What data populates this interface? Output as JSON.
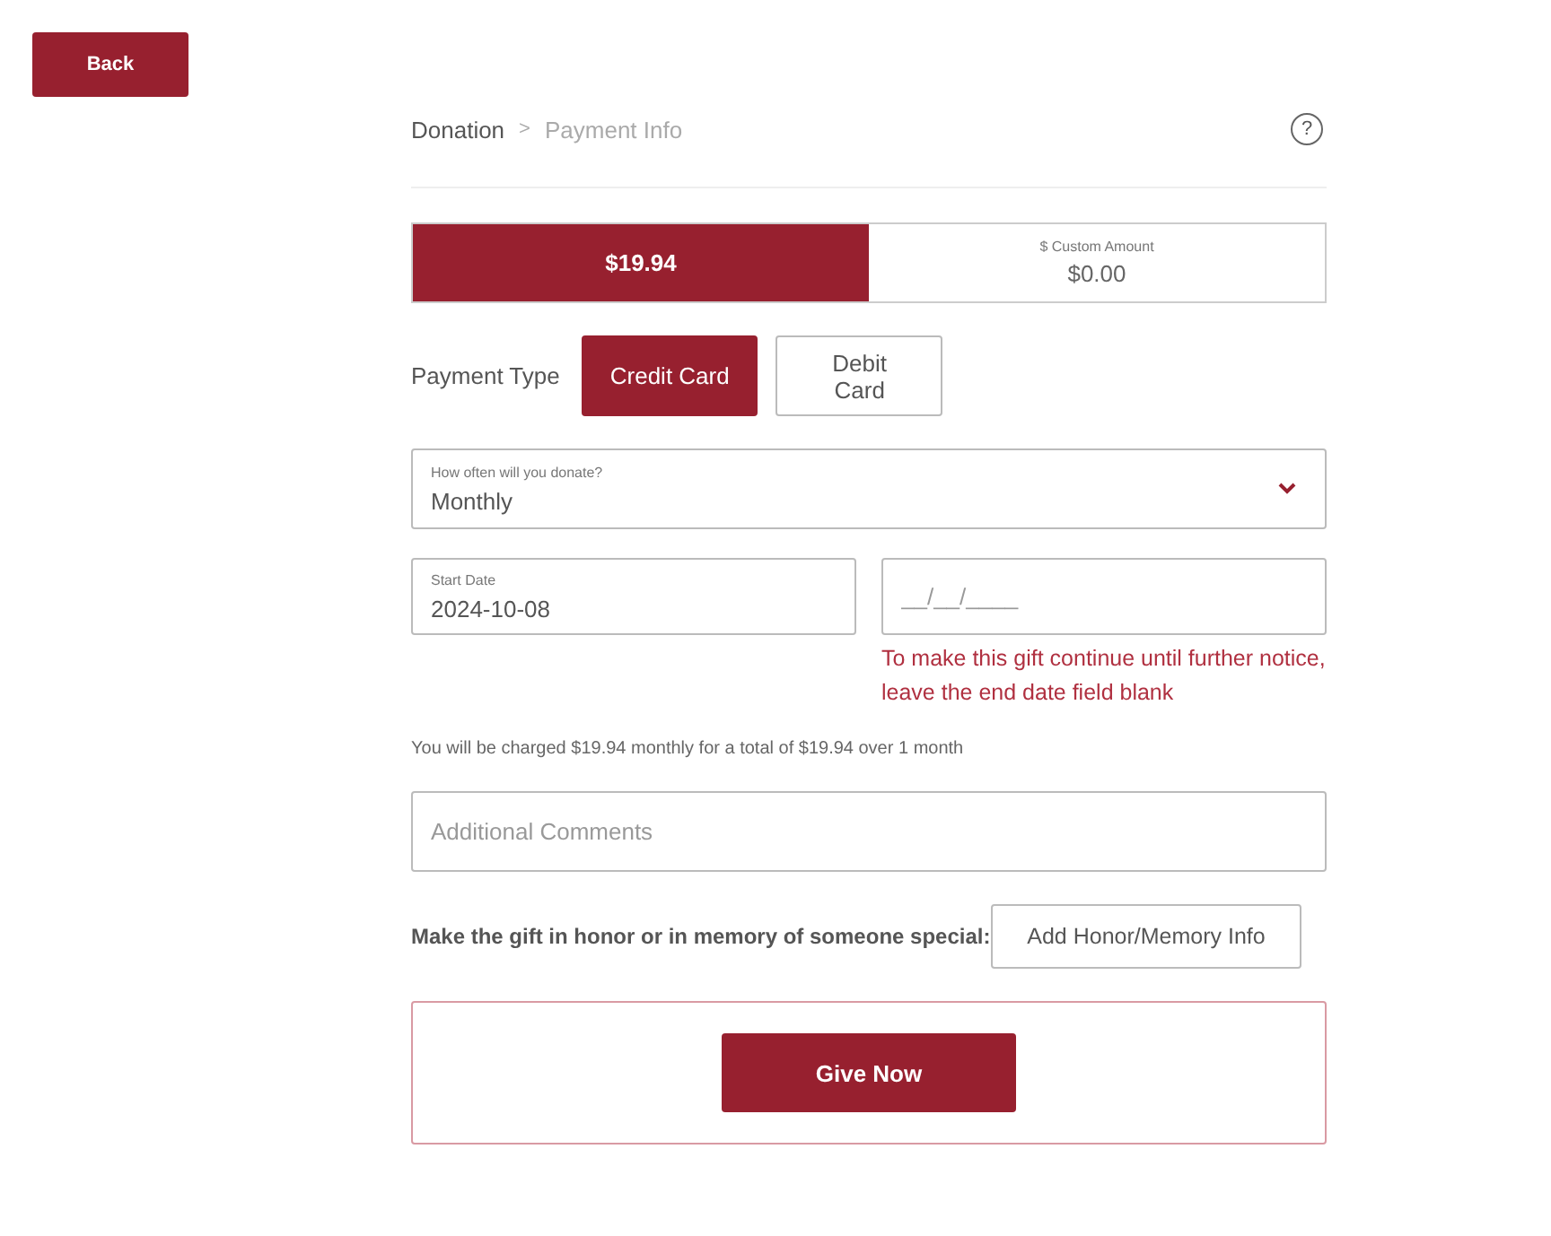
{
  "back_button": "Back",
  "breadcrumb": [
    "Donation",
    "Payment Info"
  ],
  "breadcrumb_separator": ">",
  "help_icon": "?",
  "amounts": [
    {
      "kind": "fixed",
      "value": "$19.94",
      "selected": true
    },
    {
      "kind": "custom",
      "label": "$ Custom Amount",
      "value": "$0.00",
      "selected": false
    }
  ],
  "payment_type": {
    "label": "Payment Type",
    "options": [
      {
        "label": "Credit Card",
        "selected": true
      },
      {
        "label": "Debit Card",
        "selected": false
      }
    ]
  },
  "frequency": {
    "label": "How often will you donate?",
    "value": "Monthly"
  },
  "start_date": {
    "label": "Start Date",
    "value": "2024-10-08"
  },
  "end_date": {
    "placeholder": "__/__/____",
    "hint": "To make this gift continue until further notice, leave the end date field blank"
  },
  "summary": "You will be charged $19.94 monthly for a total of $19.94 over 1 month",
  "comments": {
    "placeholder": "Additional Comments"
  },
  "honor": {
    "label": "Make the gift in honor or in memory of someone special:",
    "button": "Add Honor/Memory Info"
  },
  "submit_button": "Give Now"
}
